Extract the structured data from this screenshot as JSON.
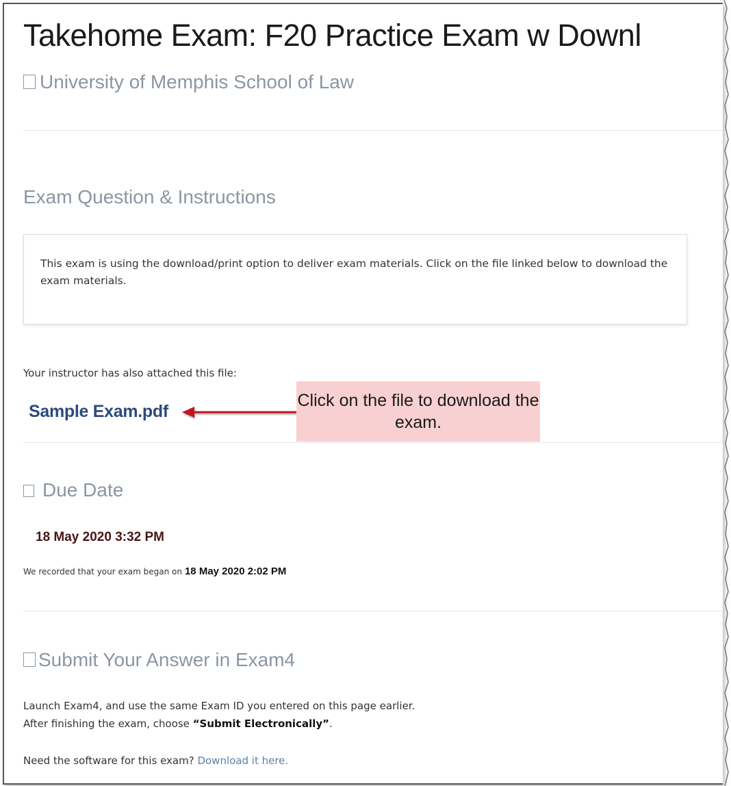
{
  "header": {
    "title": "Takehome Exam:  F20 Practice Exam w Downl",
    "school": "University of Memphis School of Law"
  },
  "instructions": {
    "heading": "Exam Question & Instructions",
    "body": "This exam is using the download/print option to deliver exam materials. Click on the file linked below to download the exam materials."
  },
  "attachment": {
    "label": "Your instructor has also attached this file:",
    "file_name": "Sample Exam.pdf",
    "callout": "Click on the file to download the exam."
  },
  "due": {
    "heading": "Due Date",
    "date": "18 May 2020  3:32 PM",
    "began_label": "We recorded that your exam began on",
    "began_date": "18 May 2020  2:02 PM"
  },
  "submit": {
    "heading": "Submit Your Answer in Exam4",
    "line1": "Launch Exam4, and use the same Exam ID you entered on this page earlier.",
    "line2_prefix": "After finishing the exam, choose ",
    "line2_bold": "“Submit Electronically”",
    "line2_suffix": ".",
    "need_software": "Need the software for this exam? ",
    "download_link": "Download it here."
  },
  "colors": {
    "heading_gray": "#8a96a3",
    "link_blue": "#2b4a7d",
    "callout_pink": "#f8d0d1",
    "arrow_red": "#c0161c",
    "due_date_maroon": "#4a1616"
  }
}
